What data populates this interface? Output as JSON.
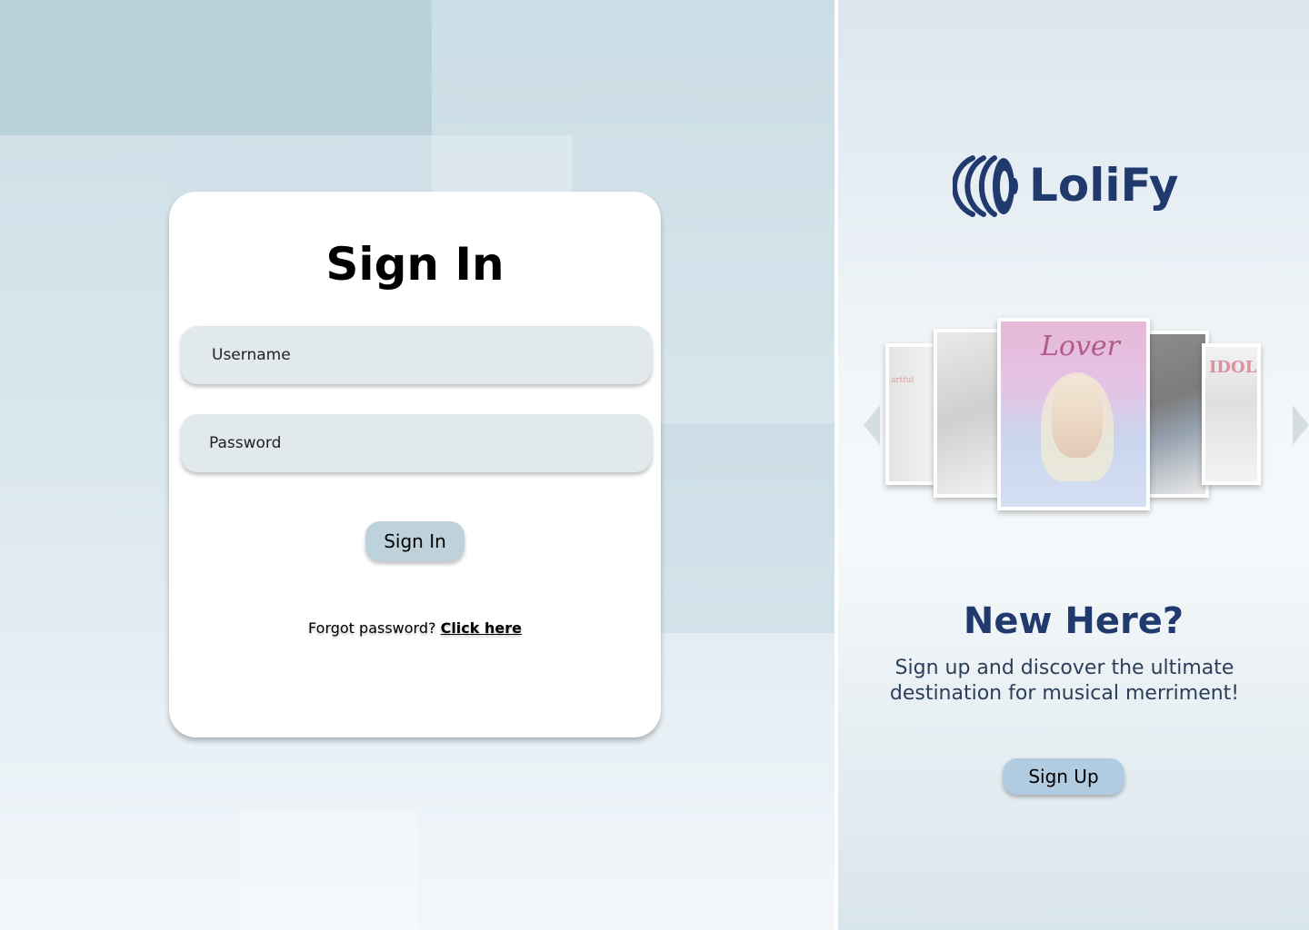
{
  "signin": {
    "title": "Sign In",
    "username_placeholder": "Username",
    "password_placeholder": "Password",
    "submit_label": "Sign In",
    "forgot_text": "Forgot password? ",
    "forgot_link": "Click here"
  },
  "brand": {
    "name": "LoliFy",
    "color": "#213a6e"
  },
  "carousel": {
    "covers": [
      {
        "label": "artful"
      },
      {
        "label": ""
      },
      {
        "label": "Lover"
      },
      {
        "label": ""
      },
      {
        "label": "IDOL"
      }
    ]
  },
  "signup": {
    "heading": "New Here?",
    "description": "Sign up and discover the ultimate destination for musical merriment!",
    "button_label": "Sign Up"
  },
  "colors": {
    "accent_button_signin": "#bed2db",
    "accent_button_signup": "#b1cbe0",
    "field_bg": "#e1e9ec"
  }
}
